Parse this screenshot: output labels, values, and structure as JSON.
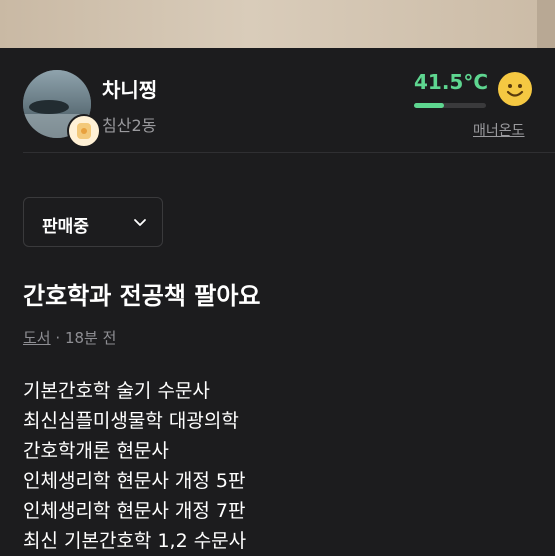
{
  "seller": {
    "nickname": "차니찡",
    "location": "침산2동"
  },
  "manner": {
    "temperature": "41.5°C",
    "bar_fill_percent": 41.5,
    "link_label": "매너온도",
    "accent_color": "#5ed690",
    "face_icon": "smile-face-icon"
  },
  "status_select": {
    "selected": "판매중"
  },
  "post": {
    "title": "간호학과 전공책 팔아요",
    "category": "도서",
    "time": "18분 전",
    "description_lines": [
      "기본간호학 술기 수문사",
      "최신심플미생물학 대광의학",
      "간호학개론 현문사",
      "인체생리학 현문사 개정 5판",
      "인체생리학 현문사 개정 7판",
      "최신 기본간호학 1,2 수문사"
    ]
  }
}
